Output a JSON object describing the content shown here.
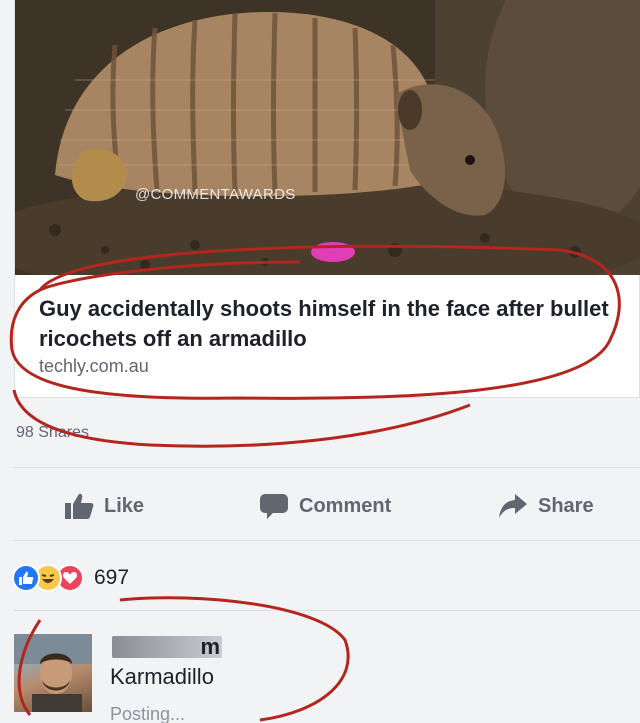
{
  "post": {
    "image_watermark": "@COMMENTAWARDS",
    "link_title": "Guy accidentally shoots himself in the face after bullet ricochets off an armadillo",
    "link_domain": "techly.com.au",
    "shares_text": "98 Shares"
  },
  "actions": {
    "like_label": "Like",
    "comment_label": "Comment",
    "share_label": "Share"
  },
  "reactions": {
    "types": [
      "like",
      "haha",
      "love"
    ],
    "count": "697"
  },
  "comment": {
    "author_partial": "m",
    "text": "Karmadillo",
    "status": "Posting..."
  },
  "colors": {
    "like_blue": "#2078f4",
    "haha_yellow": "#f7c84b",
    "love_red": "#f0435a",
    "marker_red": "#b3261e"
  }
}
